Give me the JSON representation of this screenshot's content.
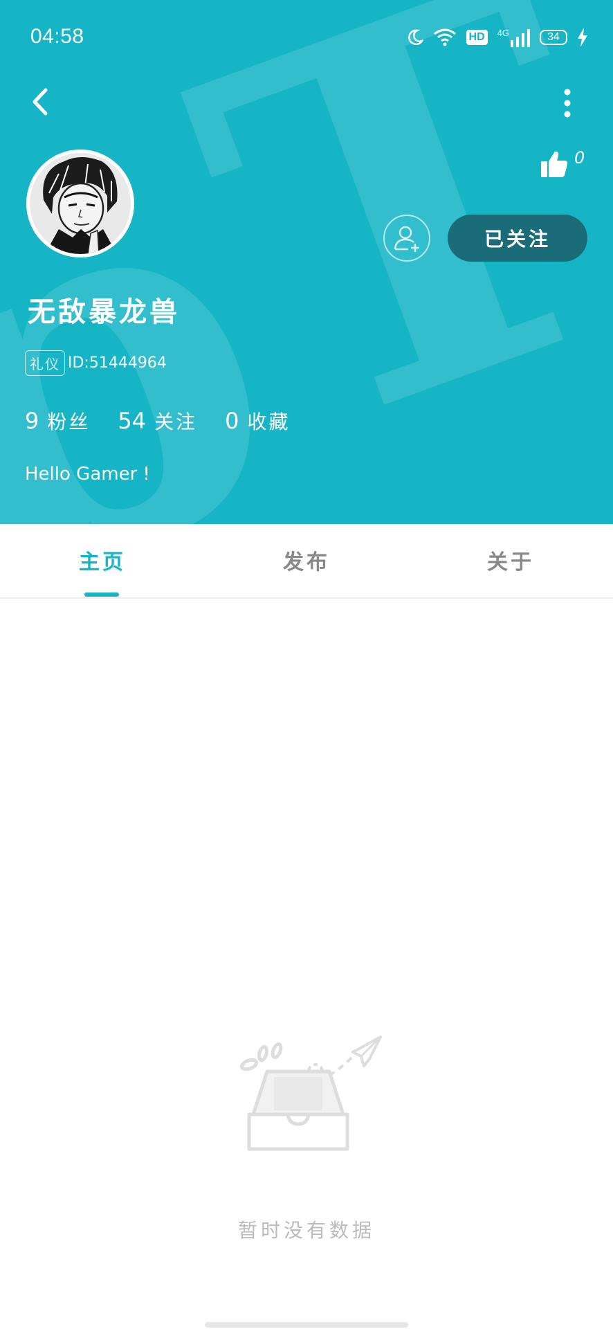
{
  "status_bar": {
    "time": "04:58",
    "icons": [
      "moon-icon",
      "wifi-icon",
      "hd-badge",
      "signal-4g-icon",
      "battery-icon",
      "charging-icon"
    ],
    "hd": "HD",
    "network": "4G",
    "battery": "34"
  },
  "header": {
    "background_color": "#16b5c6",
    "back_icon": "chevron-left-icon",
    "more_icon": "more-vertical-icon",
    "like_count": "0",
    "username": "无敌暴龙兽",
    "badge": "礼仪",
    "user_id": "ID:51444964",
    "follow_button": "已关注",
    "stats": [
      {
        "value": "9",
        "label": "粉丝"
      },
      {
        "value": "54",
        "label": "关注"
      },
      {
        "value": "0",
        "label": "收藏"
      }
    ],
    "bio": "Hello Gamer !"
  },
  "tabs": [
    {
      "label": "主页",
      "active": true
    },
    {
      "label": "发布",
      "active": false
    },
    {
      "label": "关于",
      "active": false
    }
  ],
  "accent_color": "#16b5c6",
  "empty_state": {
    "icon": "empty-inbox-icon",
    "text": "暂时没有数据"
  }
}
